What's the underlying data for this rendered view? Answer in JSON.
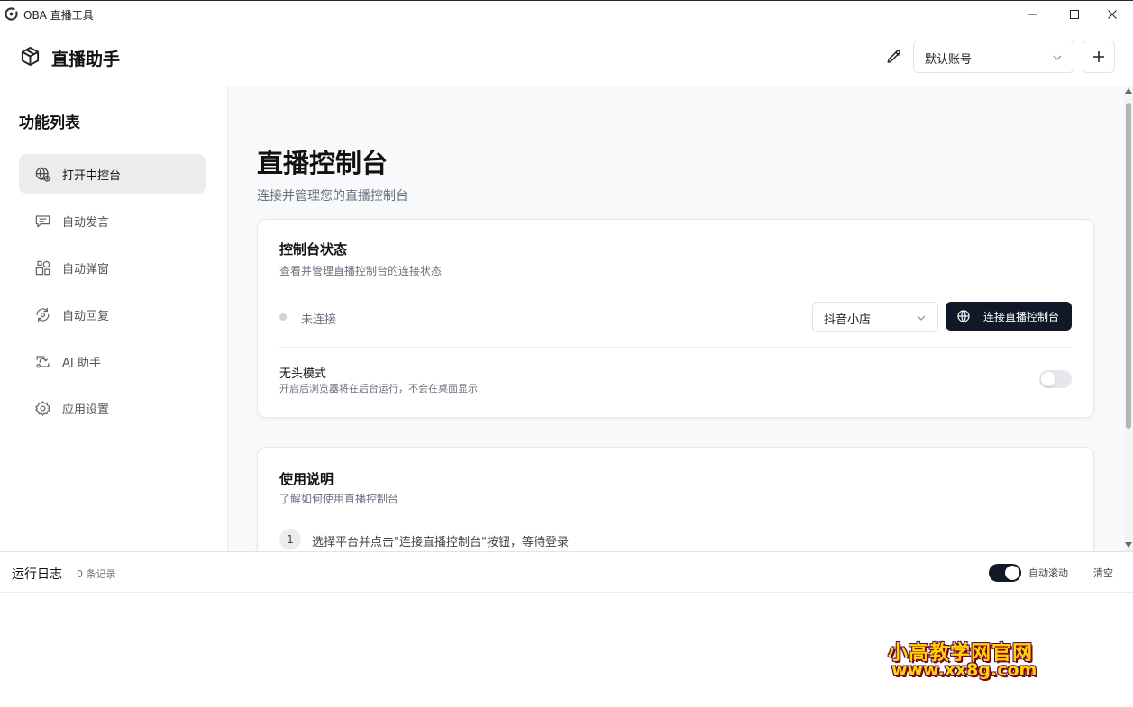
{
  "window": {
    "title": "OBA 直播工具"
  },
  "header": {
    "brand_title": "直播助手",
    "account_select_value": "默认账号"
  },
  "sidebar": {
    "title": "功能列表",
    "items": [
      {
        "label": "打开中控台",
        "icon": "globe-icon",
        "active": true
      },
      {
        "label": "自动发言",
        "icon": "message-icon",
        "active": false
      },
      {
        "label": "自动弹窗",
        "icon": "shapes-icon",
        "active": false
      },
      {
        "label": "自动回复",
        "icon": "refresh-chat-icon",
        "active": false
      },
      {
        "label": "AI 助手",
        "icon": "ai-icon",
        "active": false
      },
      {
        "label": "应用设置",
        "icon": "gear-icon",
        "active": false
      }
    ]
  },
  "main": {
    "title": "直播控制台",
    "subtitle": "连接并管理您的直播控制台",
    "status_card": {
      "title": "控制台状态",
      "subtitle": "查看并管理直播控制台的连接状态",
      "status_text": "未连接",
      "platform_select_value": "抖音小店",
      "connect_button_label": "连接直播控制台",
      "headless_title": "无头模式",
      "headless_desc": "开启后浏览器将在后台运行，不会在桌面显示",
      "headless_enabled": false
    },
    "usage_card": {
      "title": "使用说明",
      "subtitle": "了解如何使用直播控制台",
      "steps": [
        {
          "num": "1",
          "text": "选择平台并点击\"连接直播控制台\"按钮，等待登录"
        }
      ]
    }
  },
  "log": {
    "title": "运行日志",
    "count": "0 条记录",
    "autoscroll_label": "自动滚动",
    "autoscroll_enabled": true,
    "clear_label": "清空"
  },
  "watermark": {
    "line1": "小高教学网官网",
    "line2": "www.xx8g.com"
  },
  "colors": {
    "accent_dark": "#111827",
    "active_nav_bg": "#ececec",
    "main_bg": "#f8f9fa"
  }
}
